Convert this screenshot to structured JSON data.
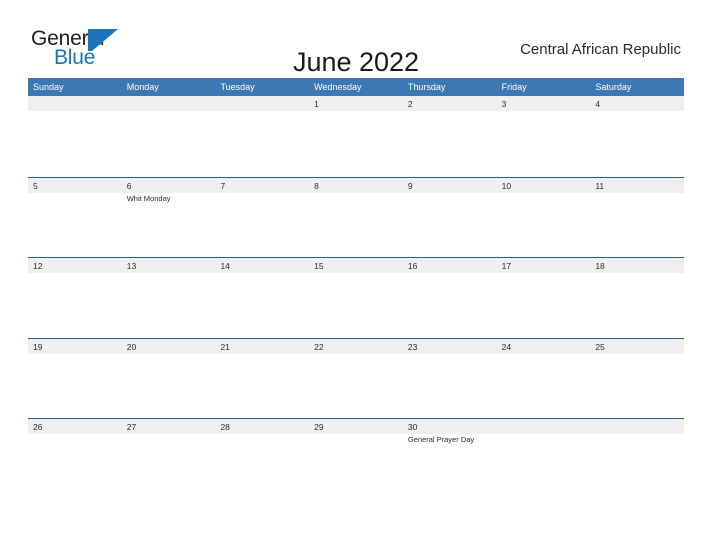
{
  "brand": {
    "name_part1": "General",
    "name_part2": "Blue",
    "accent_color": "#1b75bc",
    "logo_mark_icon": "triangle-flag-icon"
  },
  "header": {
    "title": "June 2022",
    "country": "Central African Republic"
  },
  "calendar": {
    "header_bg_color": "#3b78b4",
    "row_band_color": "#efefef",
    "row_border_color": "#2b6199",
    "weekdays": [
      "Sunday",
      "Monday",
      "Tuesday",
      "Wednesday",
      "Thursday",
      "Friday",
      "Saturday"
    ],
    "weeks": [
      {
        "days": [
          {
            "date": "",
            "event": ""
          },
          {
            "date": "",
            "event": ""
          },
          {
            "date": "",
            "event": ""
          },
          {
            "date": "1",
            "event": ""
          },
          {
            "date": "2",
            "event": ""
          },
          {
            "date": "3",
            "event": ""
          },
          {
            "date": "4",
            "event": ""
          }
        ]
      },
      {
        "days": [
          {
            "date": "5",
            "event": ""
          },
          {
            "date": "6",
            "event": "Whit Monday"
          },
          {
            "date": "7",
            "event": ""
          },
          {
            "date": "8",
            "event": ""
          },
          {
            "date": "9",
            "event": ""
          },
          {
            "date": "10",
            "event": ""
          },
          {
            "date": "11",
            "event": ""
          }
        ]
      },
      {
        "days": [
          {
            "date": "12",
            "event": ""
          },
          {
            "date": "13",
            "event": ""
          },
          {
            "date": "14",
            "event": ""
          },
          {
            "date": "15",
            "event": ""
          },
          {
            "date": "16",
            "event": ""
          },
          {
            "date": "17",
            "event": ""
          },
          {
            "date": "18",
            "event": ""
          }
        ]
      },
      {
        "days": [
          {
            "date": "19",
            "event": ""
          },
          {
            "date": "20",
            "event": ""
          },
          {
            "date": "21",
            "event": ""
          },
          {
            "date": "22",
            "event": ""
          },
          {
            "date": "23",
            "event": ""
          },
          {
            "date": "24",
            "event": ""
          },
          {
            "date": "25",
            "event": ""
          }
        ]
      },
      {
        "days": [
          {
            "date": "26",
            "event": ""
          },
          {
            "date": "27",
            "event": ""
          },
          {
            "date": "28",
            "event": ""
          },
          {
            "date": "29",
            "event": ""
          },
          {
            "date": "30",
            "event": "General Prayer Day"
          },
          {
            "date": "",
            "event": ""
          },
          {
            "date": "",
            "event": ""
          }
        ]
      }
    ]
  }
}
